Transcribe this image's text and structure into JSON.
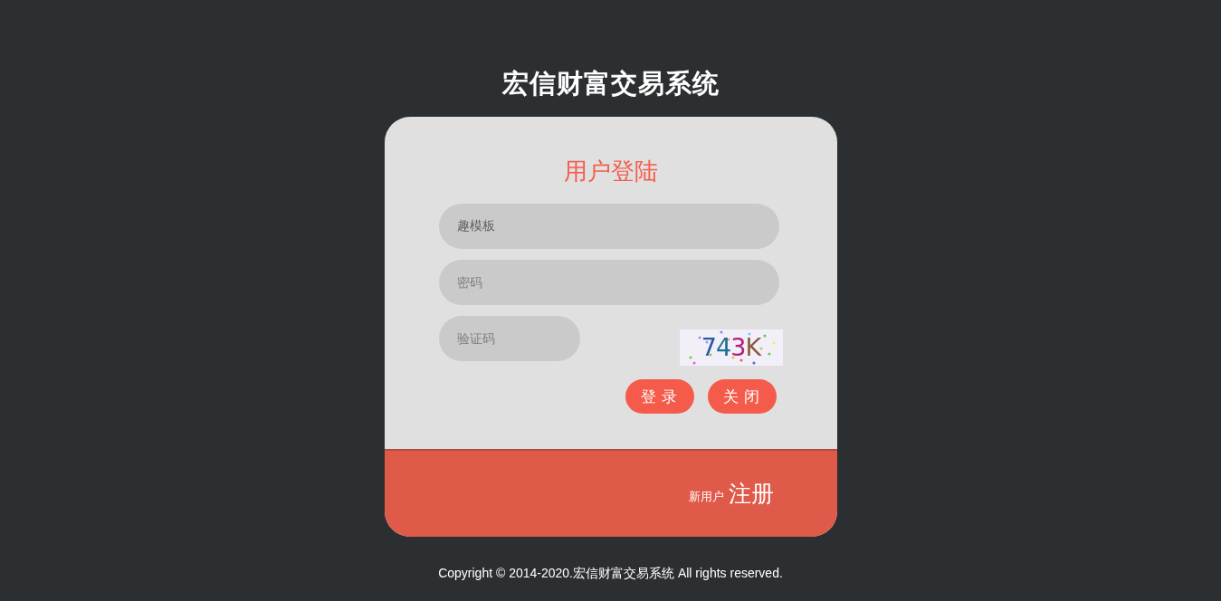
{
  "header": {
    "title": "宏信财富交易系统"
  },
  "login": {
    "heading": "用户登陆",
    "fields": [
      {
        "kind": "text",
        "value": "趣模板"
      },
      {
        "kind": "password",
        "placeholder": "密码"
      },
      {
        "kind": "captcha",
        "placeholder": "验证码"
      }
    ],
    "captcha": {
      "code": "743K"
    },
    "buttons": [
      {
        "label": "登 录"
      },
      {
        "label": "关 闭"
      }
    ]
  },
  "register": {
    "prompt": "新用户",
    "link": "注册"
  },
  "footer": {
    "copyright": "Copyright © 2014-2020.宏信财富交易系统 All rights reserved."
  }
}
